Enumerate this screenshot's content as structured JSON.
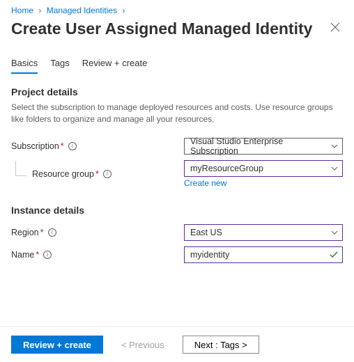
{
  "breadcrumb": {
    "home": "Home",
    "managed_identities": "Managed Identities"
  },
  "title": "Create User Assigned Managed Identity",
  "tabs": {
    "basics": "Basics",
    "tags": "Tags",
    "review": "Review + create"
  },
  "project_details": {
    "heading": "Project details",
    "description": "Select the subscription to manage deployed resources and costs. Use resource groups like folders to organize and manage all your resources."
  },
  "fields": {
    "subscription": {
      "label": "Subscription",
      "value": "Visual Studio Enterprise Subscription"
    },
    "resource_group": {
      "label": "Resource group",
      "value": "myResourceGroup",
      "create_new": "Create new"
    }
  },
  "instance_details": {
    "heading": "Instance details",
    "region": {
      "label": "Region",
      "value": "East US"
    },
    "name": {
      "label": "Name",
      "value": "myidentity"
    }
  },
  "footer": {
    "review": "Review + create",
    "previous": "< Previous",
    "next": "Next : Tags >"
  }
}
